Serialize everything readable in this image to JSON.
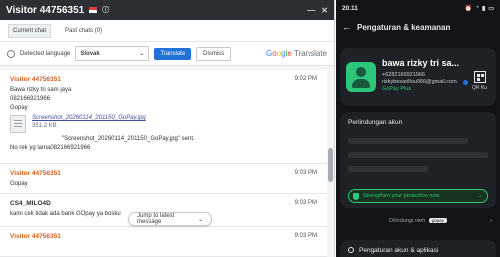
{
  "chat": {
    "title": "Visitor 44756351",
    "tabs": [
      "Current chat",
      "Past chats (0)"
    ],
    "translate": {
      "detected_label": "Detected language",
      "language": "Slovak",
      "translate_button": "Translate",
      "dismiss_button": "Dismiss",
      "brand": "Google Translate"
    },
    "messages": [
      {
        "sender": "Visitor 44756351",
        "time": "9:02 PM",
        "lines": [
          "Bawa rizky tri sam jaya",
          "082166921966",
          "Gopay"
        ],
        "attachment": {
          "name": "Screenshot_20260114_201150_GoPay.jpg",
          "size": "351.2 KB"
        },
        "after": "\"Screenshot_20260114_201150_GoPay.jpg\" sent.",
        "extra": "No rek yg lama082166921966"
      },
      {
        "sender": "Visitor 44756351",
        "time": "9:03 PM",
        "lines": [
          "Gopay"
        ]
      },
      {
        "sender": "CS4_MILO4D",
        "time": "9:03 PM",
        "lines": [
          "kami cek tidak ada bank GOpay ya bosku"
        ]
      },
      {
        "sender": "Visitor 44756351",
        "time": "9:03 PM",
        "lines": []
      }
    ],
    "jump_label": "Jump to latest message"
  },
  "phone": {
    "time": "20.11",
    "screen_title": "Pengaturan & keamanan",
    "profile": {
      "name": "bawa rizky tri sa...",
      "phone": "+6282166921966",
      "email": "rizkybesarillou066@gmail.com",
      "tier": "GoPay Plus",
      "qr_label": "QR Ku"
    },
    "protection": {
      "title": "Perlindungan akun",
      "strength_label": "Strengthen your protection now"
    },
    "powered_by": "Dilindungi oleh",
    "powered_badge": "gopay",
    "settings_row": "Pengaturan akun & aplikasi"
  }
}
